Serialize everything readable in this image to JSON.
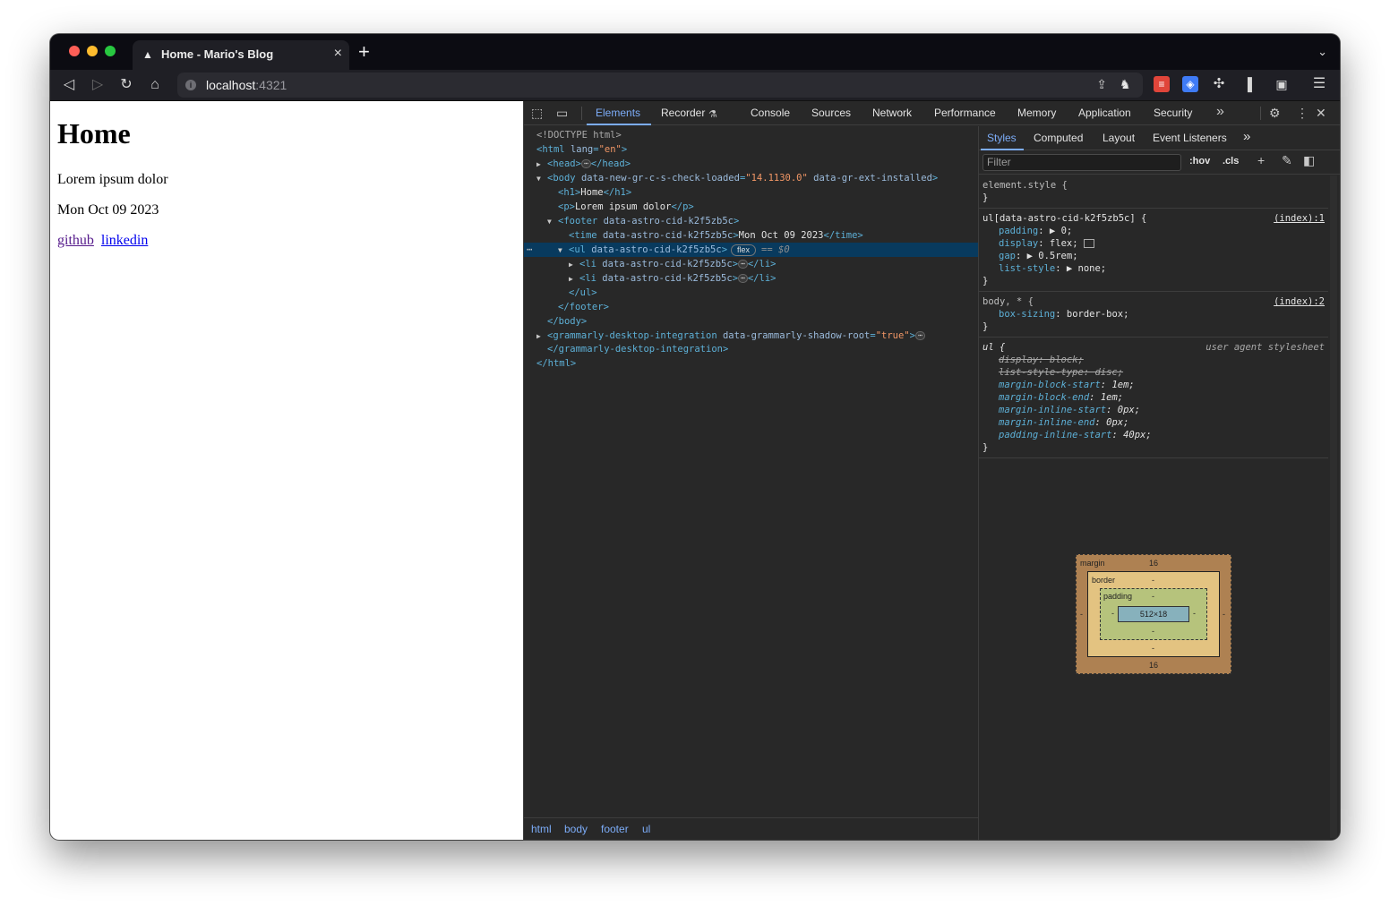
{
  "browser": {
    "tab_title": "Home - Mario's Blog",
    "tab_close": "×",
    "new_tab": "+",
    "tab_menu": "⌄",
    "url_host": "localhost",
    "url_port": ":4321"
  },
  "page": {
    "heading": "Home",
    "paragraph": "Lorem ipsum dolor",
    "time": "Mon Oct 09 2023",
    "links": [
      "github",
      "linkedin"
    ]
  },
  "devtools": {
    "tabs": [
      "Elements",
      "Recorder",
      "Console",
      "Sources",
      "Network",
      "Performance",
      "Memory",
      "Application",
      "Security"
    ],
    "more": "»",
    "elements_tree": {
      "doctype": "<!DOCTYPE html>",
      "html_open_tag": "<html",
      "html_lang_attr": "lang",
      "html_lang_val": "\"en\"",
      "head_open": "<head>",
      "head_close": "</head>",
      "body_open": "<body",
      "body_attr1": "data-new-gr-c-s-check-loaded",
      "body_attr1_val": "\"14.1130.0\"",
      "body_attr2": "data-gr-ext-installed",
      "h1_open": "<h1>",
      "h1_text": "Home",
      "h1_close": "</h1>",
      "p_open": "<p>",
      "p_text": "Lorem ipsum dolor",
      "p_close": "</p>",
      "footer_open": "<footer",
      "astro_attr": "data-astro-cid-k2f5zb5c",
      "time_open": "<time",
      "time_text": "Mon Oct 09 2023",
      "time_close": "</time>",
      "ul_open": "<ul",
      "flex_badge": "flex",
      "dollar": "== $0",
      "li_open": "<li",
      "li_close": "</li>",
      "ul_close": "</ul>",
      "footer_close": "</footer>",
      "body_close": "</body>",
      "gram_open": "<grammarly-desktop-integration",
      "gram_attr": "data-grammarly-shadow-root",
      "gram_val": "\"true\"",
      "gram_close": "</grammarly-desktop-integration>",
      "html_close": "</html>",
      "ellipsis": "⋯",
      "gt": ">"
    },
    "breadcrumbs": [
      "html",
      "body",
      "footer",
      "ul"
    ],
    "side_tabs": [
      "Styles",
      "Computed",
      "Layout",
      "Event Listeners"
    ],
    "filter_placeholder": "Filter",
    "hov": ":hov",
    "cls": ".cls",
    "styles": {
      "element_style": "element.style {",
      "close_brace": "}",
      "rule1_selector": "ul[data-astro-cid-k2f5zb5c] {",
      "rule1_source": "(index):1",
      "rule1_props": [
        {
          "name": "padding",
          "value": "▶ 0;"
        },
        {
          "name": "display",
          "value": "flex;"
        },
        {
          "name": "gap",
          "value": "▶ 0.5rem;"
        },
        {
          "name": "list-style",
          "value": "▶ none;"
        }
      ],
      "rule2_selector": "body, * {",
      "rule2_source": "(index):2",
      "rule2_props": [
        {
          "name": "box-sizing",
          "value": "border-box;"
        }
      ],
      "rule3_selector": "ul {",
      "rule3_source": "user agent stylesheet",
      "rule3_struck": [
        "display: block;",
        "list-style-type: disc;"
      ],
      "rule3_props": [
        {
          "name": "margin-block-start",
          "value": "1em;"
        },
        {
          "name": "margin-block-end",
          "value": "1em;"
        },
        {
          "name": "margin-inline-start",
          "value": "0px;"
        },
        {
          "name": "margin-inline-end",
          "value": "0px;"
        },
        {
          "name": "padding-inline-start",
          "value": "40px;"
        }
      ]
    },
    "box_model": {
      "margin_label": "margin",
      "margin_top": "16",
      "margin_bottom": "16",
      "margin_side": "-",
      "border_label": "border",
      "padding_label": "padding",
      "dash": "-",
      "content": "512×18"
    }
  }
}
